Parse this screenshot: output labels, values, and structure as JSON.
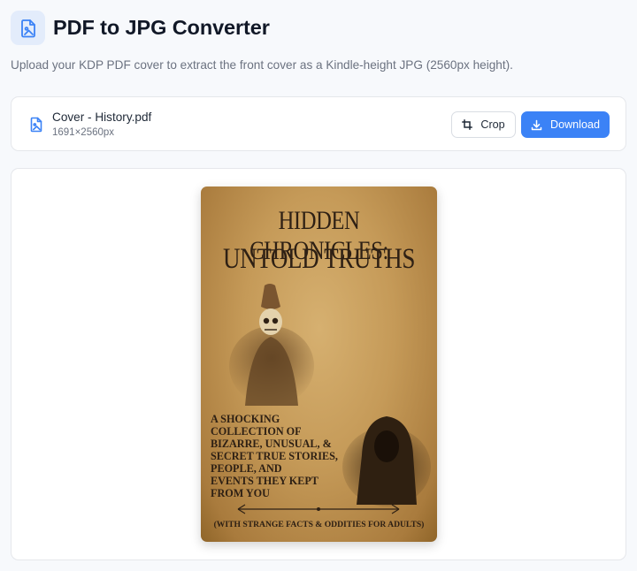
{
  "app": {
    "title": "PDF to JPG Converter",
    "subtitle": "Upload your KDP PDF cover to extract the front cover as a Kindle-height JPG (2560px height)."
  },
  "file": {
    "name": "Cover - History.pdf",
    "dimensions": "1691×2560px",
    "icon": "file-image-icon"
  },
  "actions": {
    "crop_label": "Crop",
    "crop_icon": "crop-icon",
    "download_label": "Download",
    "download_icon": "download-icon"
  },
  "cover": {
    "title_line1": "HIDDEN CHRONICLES:",
    "title_line2": "UNTOLD TRUTHS",
    "blurb_lines": [
      "A SHOCKING",
      "COLLECTION OF",
      "BIZARRE, UNUSUAL, &",
      "SECRET TRUE STORIES,",
      "PEOPLE, AND",
      "EVENTS THEY KEPT",
      "FROM YOU"
    ],
    "footer": "(WITH STRANGE FACTS & ODDITIES FOR ADULTS)"
  },
  "colors": {
    "accent": "#3b82f6",
    "background": "#f7f9fc",
    "card_border": "#e5e7eb",
    "cover_ink": "#2e2014"
  }
}
